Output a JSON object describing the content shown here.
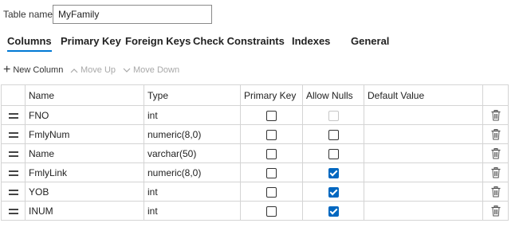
{
  "table_name": {
    "label": "Table name",
    "value": "MyFamily"
  },
  "tabs": [
    {
      "label": "Columns",
      "active": true
    },
    {
      "label": "Primary Key",
      "active": false
    },
    {
      "label": "Foreign Keys",
      "active": false
    },
    {
      "label": "Check Constraints",
      "active": false
    },
    {
      "label": "Indexes",
      "active": false
    },
    {
      "label": "General",
      "active": false
    }
  ],
  "toolbar": {
    "new_column": "New Column",
    "move_up": "Move Up",
    "move_down": "Move Down"
  },
  "columns_grid": {
    "headers": [
      "Name",
      "Type",
      "Primary Key",
      "Allow Nulls",
      "Default Value"
    ],
    "rows": [
      {
        "name": "FNO",
        "type": "int",
        "primary_key": false,
        "allow_nulls": false,
        "allow_nulls_disabled": true,
        "default": ""
      },
      {
        "name": "FmlyNum",
        "type": "numeric(8,0)",
        "primary_key": false,
        "allow_nulls": false,
        "allow_nulls_disabled": false,
        "default": ""
      },
      {
        "name": "Name",
        "type": "varchar(50)",
        "primary_key": false,
        "allow_nulls": false,
        "allow_nulls_disabled": false,
        "default": ""
      },
      {
        "name": "FmlyLink",
        "type": "numeric(8,0)",
        "primary_key": false,
        "allow_nulls": true,
        "allow_nulls_disabled": false,
        "default": ""
      },
      {
        "name": "YOB",
        "type": "int",
        "primary_key": false,
        "allow_nulls": true,
        "allow_nulls_disabled": false,
        "default": ""
      },
      {
        "name": "INUM",
        "type": "int",
        "primary_key": false,
        "allow_nulls": true,
        "allow_nulls_disabled": false,
        "default": ""
      }
    ]
  },
  "colors": {
    "accent": "#0067c0",
    "tab_underline": "#0078d4",
    "disabled_text": "#a8a8a8",
    "grid_border": "#d4d4d4"
  },
  "icons": {
    "row_handle": "drag-handle-icon",
    "delete": "trash-icon",
    "new": "plus-icon",
    "up": "chevron-up-icon",
    "down": "chevron-down-icon"
  }
}
